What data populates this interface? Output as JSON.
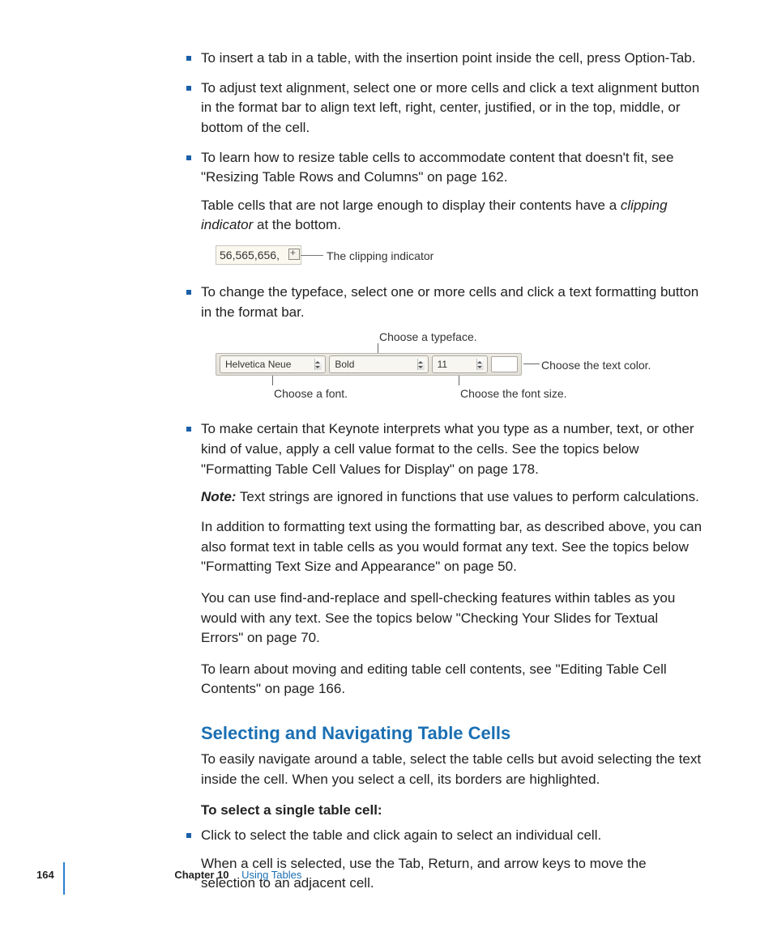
{
  "bullets": {
    "b1": "To insert a tab in a table, with the insertion point inside the cell, press Option-Tab.",
    "b2": "To adjust text alignment, select one or more cells and click a text alignment button in the format bar to align text left, right, center, justified, or in the top, middle, or bottom of the cell.",
    "b3": "To learn how to resize table cells to accommodate content that doesn't fit, see \"Resizing Table Rows and Columns\" on page 162.",
    "b3_sub_a": "Table cells that are not large enough to display their contents have a ",
    "b3_sub_em": "clipping indicator",
    "b3_sub_b": " at the bottom.",
    "b4": "To change the typeface, select one or more cells and click a text formatting button in the format bar.",
    "b5": "To make certain that Keynote interprets what you type as a number, text, or other kind of value, apply a cell value format to the cells. See the topics below \"Formatting Table Cell Values for Display\" on page 178.",
    "b5_note_l": "Note:",
    "b5_note": "  Text strings are ignored in functions that use values to perform calculations.",
    "b6": "Click to select the table and click again to select an individual cell.",
    "b6_sub": "When a cell is selected, use the Tab, Return, and arrow keys to move the selection to an adjacent cell."
  },
  "paras": {
    "p1": "In addition to formatting text using the formatting bar, as described above, you can also format text in table cells as you would format any text. See the topics below \"Formatting Text Size and Appearance\" on page 50.",
    "p2": "You can use find-and-replace and spell-checking features within tables as you would with any text. See the topics below \"Checking Your Slides for Textual Errors\" on page 70.",
    "p3": "To learn about moving and editing table cell contents, see \"Editing Table Cell Contents\" on page 166.",
    "p4": "To easily navigate around a table, select the table cells but avoid selecting the text inside the cell. When you select a cell, its borders are highlighted.",
    "p5": "To select a single table cell:"
  },
  "section_heading": "Selecting and Navigating Table Cells",
  "clip": {
    "cell_text": "56,565,656,",
    "caption": "The clipping indicator"
  },
  "bar": {
    "font": "Helvetica Neue",
    "style": "Bold",
    "size": "11",
    "cap_typeface": "Choose a typeface.",
    "cap_font": "Choose a font.",
    "cap_size": "Choose the font size.",
    "cap_color": "Choose the text color."
  },
  "footer": {
    "page": "164",
    "chapter": "Chapter 10",
    "title": "Using Tables"
  }
}
